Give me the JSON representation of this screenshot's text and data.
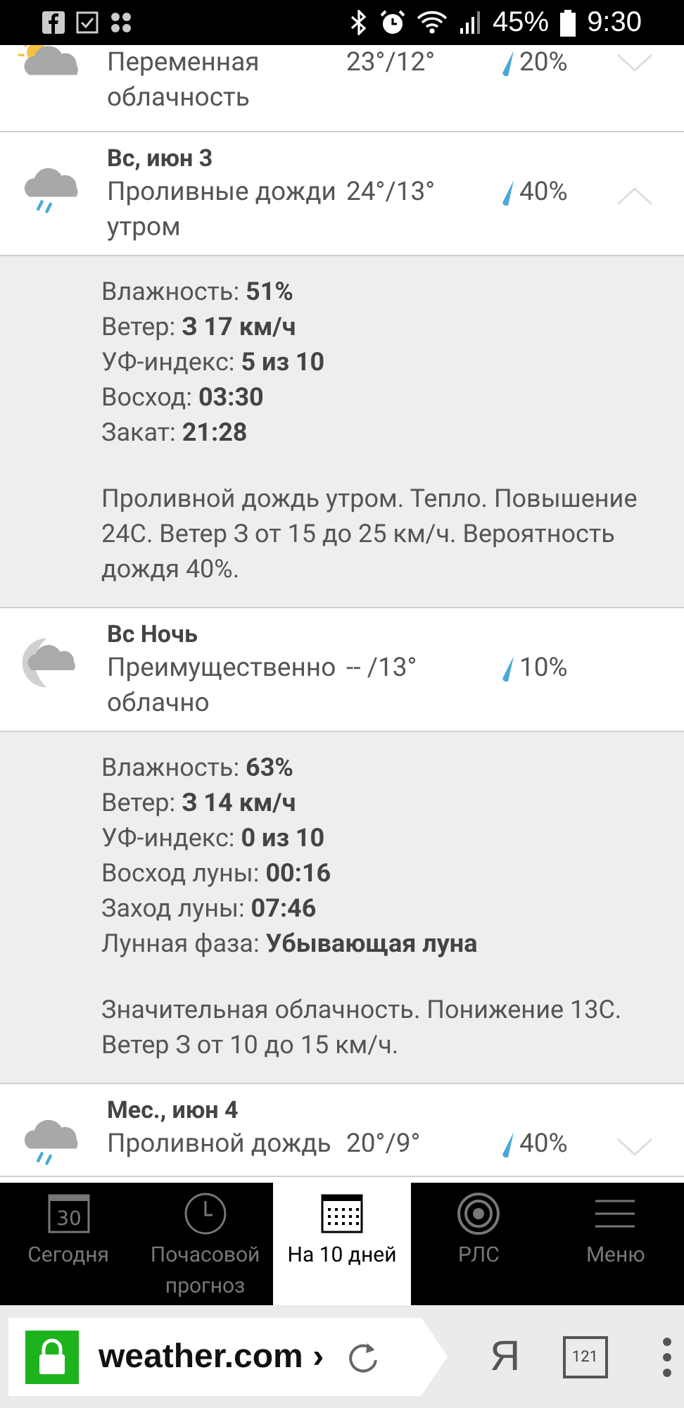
{
  "status_bar": {
    "battery": "45%",
    "time": "9:30"
  },
  "forecast": [
    {
      "kind": "partlycloudy",
      "description": "Переменная облачность",
      "temps": "23°/12°",
      "precip": "20%",
      "expanded": false
    },
    {
      "kind": "rainy",
      "date": "Вс, июн 3",
      "description": "Проливные дожди утром",
      "temps": "24°/13°",
      "precip": "40%",
      "expanded": true
    },
    {
      "kind": "details",
      "lines": [
        "Влажность: **51%**",
        "Ветер: **З 17 км/ч**",
        "УФ-индекс: **5 из 10**",
        "Восход: **03:30**",
        "Закат: **21:28**"
      ],
      "summary": "Проливной дождь утром. Тепло. Повышение 24С. Ветер З от 15 до 25 км/ч. Вероятность дождя 40%."
    },
    {
      "kind": "nightcloudy",
      "date": "Вс Ночь",
      "description": "Преимущественно облачно",
      "temps": "-- /13°",
      "precip": "10%"
    },
    {
      "kind": "details",
      "lines": [
        "Влажность: **63%**",
        "Ветер: **З 14 км/ч**",
        "УФ-индекс: **0 из 10**",
        "Восход луны: **00:16**",
        "Заход луны: **07:46**",
        "Лунная фаза: **Убывающая луна**"
      ],
      "summary": "Значительная облачность. Понижение 13С. Ветер З от 10 до 15 км/ч."
    },
    {
      "kind": "rainy",
      "date": "Мес., июн 4",
      "description": "Проливной дождь",
      "temps": "20°/9°",
      "precip": "40%",
      "expanded": false
    }
  ],
  "nav_tabs": [
    {
      "day": "30",
      "label": "Сегодня",
      "selected": false
    },
    {
      "label": "Почасовой прогноз",
      "selected": false
    },
    {
      "label": "На 10 дней",
      "selected": true
    },
    {
      "label": "РЛС",
      "selected": false
    },
    {
      "label": "Меню",
      "selected": false
    }
  ],
  "browser": {
    "url": "weather.com ›",
    "yandex": "Я",
    "tab_count": "121"
  }
}
